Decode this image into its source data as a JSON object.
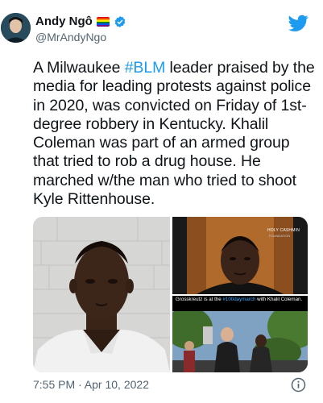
{
  "header": {
    "display_name": "Andy Ngô",
    "handle": "@MrAndyNgo"
  },
  "tweet": {
    "text_before": "A Milwaukee ",
    "hashtag": "#BLM",
    "text_after": " leader praised by the media for leading protests against police in 2020, was convicted on Friday of 1st-degree robbery in Kentucky. Khalil Coleman was part of an armed group that tried to rob a drug house. He marched w/the man who tried to shoot Kyle Rittenhouse."
  },
  "media": {
    "top_right_brand": "HOLY CASHMIN",
    "top_right_brand_sub": "FOUNDATION",
    "caption_before": "Grosskreutz is at the ",
    "caption_tag": "#100daymarch",
    "caption_after": " with Khalil Coleman."
  },
  "footer": {
    "timestamp": "7:55 PM · Apr 10, 2022"
  },
  "icons": {
    "bird": "twitter-bird-icon",
    "verified": "verified-badge-icon",
    "flag": "rainbow-flag-icon",
    "info": "info-icon"
  },
  "colors": {
    "accent": "#1d9bf0",
    "text": "#0f1419",
    "secondary": "#536471"
  }
}
